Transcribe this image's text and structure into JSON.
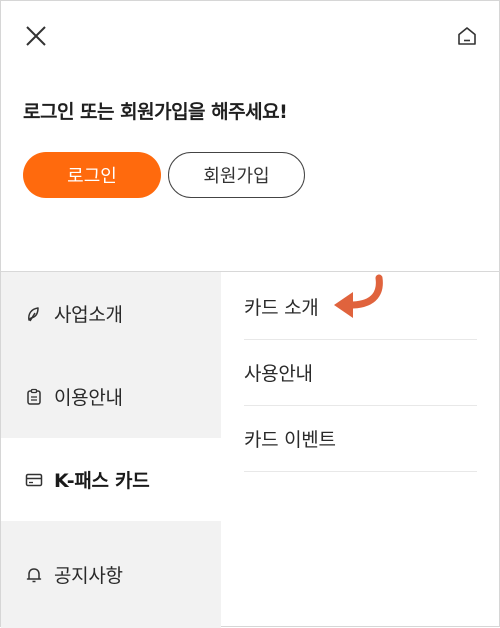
{
  "header": {
    "close_icon": "close-icon",
    "home_icon": "home-icon"
  },
  "auth": {
    "greeting": "로그인 또는 회원가입을 해주세요!",
    "login_label": "로그인",
    "signup_label": "회원가입",
    "login_color": "#ff6a0d"
  },
  "menu": {
    "categories": [
      {
        "label": "사업소개",
        "icon": "leaf-icon",
        "active": false
      },
      {
        "label": "이용안내",
        "icon": "clipboard-icon",
        "active": false
      },
      {
        "label": "K-패스 카드",
        "icon": "card-icon",
        "active": true
      },
      {
        "label": "공지사항",
        "icon": "bell-icon",
        "active": false
      }
    ],
    "subitems": [
      {
        "label": "카드 소개"
      },
      {
        "label": "사용안내"
      },
      {
        "label": "카드 이벤트"
      }
    ]
  },
  "annotation": {
    "arrow_color": "#e0633d"
  }
}
